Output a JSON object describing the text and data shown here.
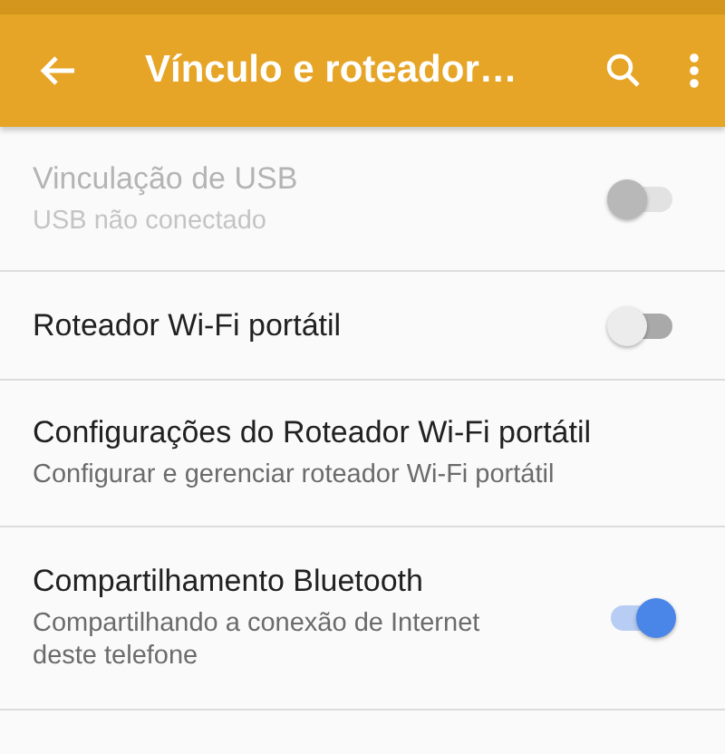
{
  "toolbar": {
    "title": "Vínculo e roteador…"
  },
  "items": [
    {
      "kind": "switch",
      "title": "Vinculação de USB",
      "subtitle": "USB não conectado",
      "disabled": true,
      "on": false
    },
    {
      "kind": "switch",
      "title": "Roteador Wi-Fi portátil",
      "disabled": false,
      "on": false
    },
    {
      "kind": "plain",
      "title": "Configurações do Roteador Wi-Fi portátil",
      "subtitle": "Configurar e gerenciar roteador Wi-Fi portátil",
      "disabled": false
    },
    {
      "kind": "switch",
      "title": "Compartilhamento Bluetooth",
      "subtitle": "Compartilhando a conexão de Internet deste telefone",
      "disabled": false,
      "on": true
    }
  ]
}
